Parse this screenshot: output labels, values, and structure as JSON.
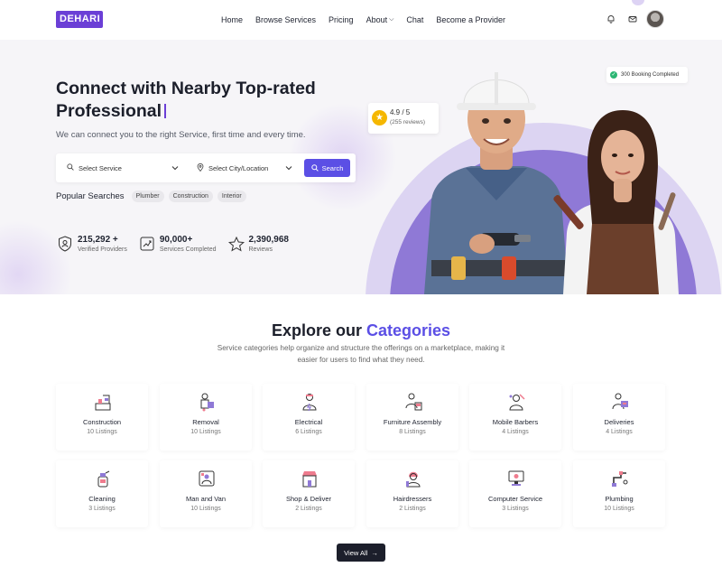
{
  "nav": {
    "logo": "DEHARI",
    "items": [
      {
        "label": "Home"
      },
      {
        "label": "Browse Services"
      },
      {
        "label": "Pricing"
      },
      {
        "label": "About"
      },
      {
        "label": "Chat"
      },
      {
        "label": "Become a Provider"
      }
    ],
    "icons": [
      "bell-icon",
      "mail-icon",
      "user-avatar"
    ]
  },
  "hero": {
    "title": "Connect with Nearby Top-rated Professional",
    "subtitle": "We can connect you to the right Service, first time and every time.",
    "search": {
      "service_placeholder": "Select Service",
      "location_placeholder": "Select City/Location",
      "button": "Search"
    },
    "popular_label": "Popular Searches",
    "popular_chips": [
      "Plumber",
      "Construction",
      "Interior"
    ],
    "stats": [
      {
        "value": "215,292 +",
        "label": "Verified Providers"
      },
      {
        "value": "90,000+",
        "label": "Services Completed"
      },
      {
        "value": "2,390,968",
        "label": "Reviews"
      }
    ],
    "rating": {
      "score": "4.9 / 5",
      "reviews": "(255 reviews)"
    },
    "booking_badge": "300 Booking Completed"
  },
  "explore": {
    "title_prefix": "Explore our",
    "title_accent": "Categories",
    "subtitle": "Service categories help organize and structure the offerings on a marketplace, making it easier for users to find what they need.",
    "categories": [
      {
        "name": "Construction",
        "listings": "10 Listings"
      },
      {
        "name": "Removal",
        "listings": "10 Listings"
      },
      {
        "name": "Electrical",
        "listings": "6 Listings"
      },
      {
        "name": "Furniture Assembly",
        "listings": "8 Listings"
      },
      {
        "name": "Mobile Barbers",
        "listings": "4 Listings"
      },
      {
        "name": "Deliveries",
        "listings": "4 Listings"
      },
      {
        "name": "Cleaning",
        "listings": "3 Listings"
      },
      {
        "name": "Man and Van",
        "listings": "10 Listings"
      },
      {
        "name": "Shop & Deliver",
        "listings": "2 Listings"
      },
      {
        "name": "Hairdressers",
        "listings": "2 Listings"
      },
      {
        "name": "Computer Service",
        "listings": "3 Listings"
      },
      {
        "name": "Plumbing",
        "listings": "10 Listings"
      }
    ],
    "view_all": "View All"
  },
  "colors": {
    "accent": "#5b4fe5",
    "brand": "#6b3fd6",
    "dark": "#1c1f2b"
  }
}
